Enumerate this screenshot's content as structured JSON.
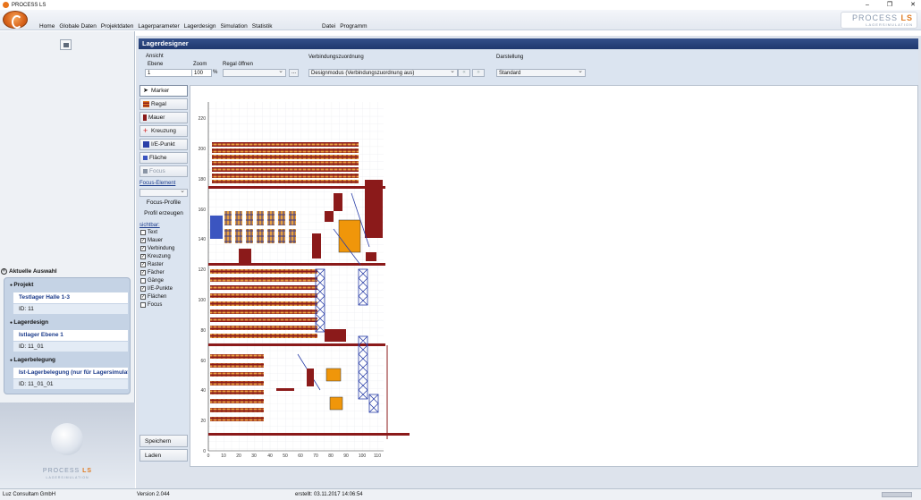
{
  "window": {
    "title": "PROCESS LS",
    "controls": [
      "–",
      "❐",
      "✕"
    ]
  },
  "menu": {
    "main": [
      "Home",
      "Globale Daten",
      "Projektdaten",
      "Lagerparameter",
      "Lagerdesign",
      "Simulation",
      "Statistik"
    ],
    "right": [
      "Datei",
      "Programm"
    ]
  },
  "brand": {
    "logo_text": "PROCESS",
    "logo_suffix": "LS",
    "logo_sub": "LAGERSIMULATION",
    "accent": "#e07b22",
    "primary": "#1f386e"
  },
  "panel": {
    "title": "Lagerdesigner"
  },
  "toolbar": {
    "ansicht_label": "Ansicht",
    "ebene_label": "Ebene",
    "ebene_value": "1",
    "zoom_label": "Zoom",
    "zoom_value": "100",
    "zoom_unit": "%",
    "regal_label": "Regal öffnen",
    "regal_value": "",
    "browse_label": "...",
    "verbindung_label": "Verbindungszuordnung",
    "verbindung_value": "Designmodus (Verbindungszuordnung aus)",
    "darstellung_label": "Darstellung",
    "darstellung_value": "Standard"
  },
  "tools": [
    {
      "label": "Marker",
      "icon": "cursor-icon"
    },
    {
      "label": "Regal",
      "icon": "shelf-icon"
    },
    {
      "label": "Mauer",
      "icon": "wall-icon"
    },
    {
      "label": "Kreuzung",
      "icon": "crossing-icon"
    },
    {
      "label": "I/E-Punkt",
      "icon": "ie-point-icon"
    },
    {
      "label": "Fläche",
      "icon": "area-icon"
    },
    {
      "label": "Focus",
      "icon": "focus-icon"
    }
  ],
  "focus": {
    "element_label": "Focus-Element",
    "profiles_label": "Focus-Profile",
    "create_label": "Profil erzeugen"
  },
  "visible": {
    "label": "sichtbar:",
    "items": [
      {
        "label": "Text",
        "checked": false
      },
      {
        "label": "Mauer",
        "checked": true
      },
      {
        "label": "Verbindung",
        "checked": true
      },
      {
        "label": "Kreuzung",
        "checked": true
      },
      {
        "label": "Raster",
        "checked": true
      },
      {
        "label": "Fächer",
        "checked": true
      },
      {
        "label": "Gänge",
        "checked": false
      },
      {
        "label": "I/E-Punkte",
        "checked": true
      },
      {
        "label": "Flächen",
        "checked": true
      },
      {
        "label": "Focus",
        "checked": false
      }
    ]
  },
  "actions": {
    "save_label": "Speichern",
    "load_label": "Laden"
  },
  "selection": {
    "header": "Aktuelle Auswahl",
    "projekt_label": "Projekt",
    "projekt_value": "Testlager Halle 1-3",
    "projekt_id": "ID: 11",
    "lagerdesign_label": "Lagerdesign",
    "lagerdesign_value": "Istlager Ebene 1",
    "lagerdesign_id": "ID: 11_01",
    "belegung_label": "Lagerbelegung",
    "belegung_value": "Ist-Lagerbelegung (nur für Lagersimulatic",
    "belegung_id": "ID: 11_01_01"
  },
  "status": {
    "company": "Luz Consultam GmbH",
    "version": "Version 2.044",
    "created": "erstellt:  03.11.2017 14:06:54"
  },
  "plan": {
    "y_ticks": [
      "0",
      "20",
      "40",
      "60",
      "80",
      "100",
      "120",
      "140",
      "160",
      "180",
      "200",
      "220"
    ],
    "x_ticks": [
      "0",
      "10",
      "20",
      "30",
      "40",
      "50",
      "60",
      "70",
      "80",
      "90",
      "100",
      "110"
    ]
  }
}
